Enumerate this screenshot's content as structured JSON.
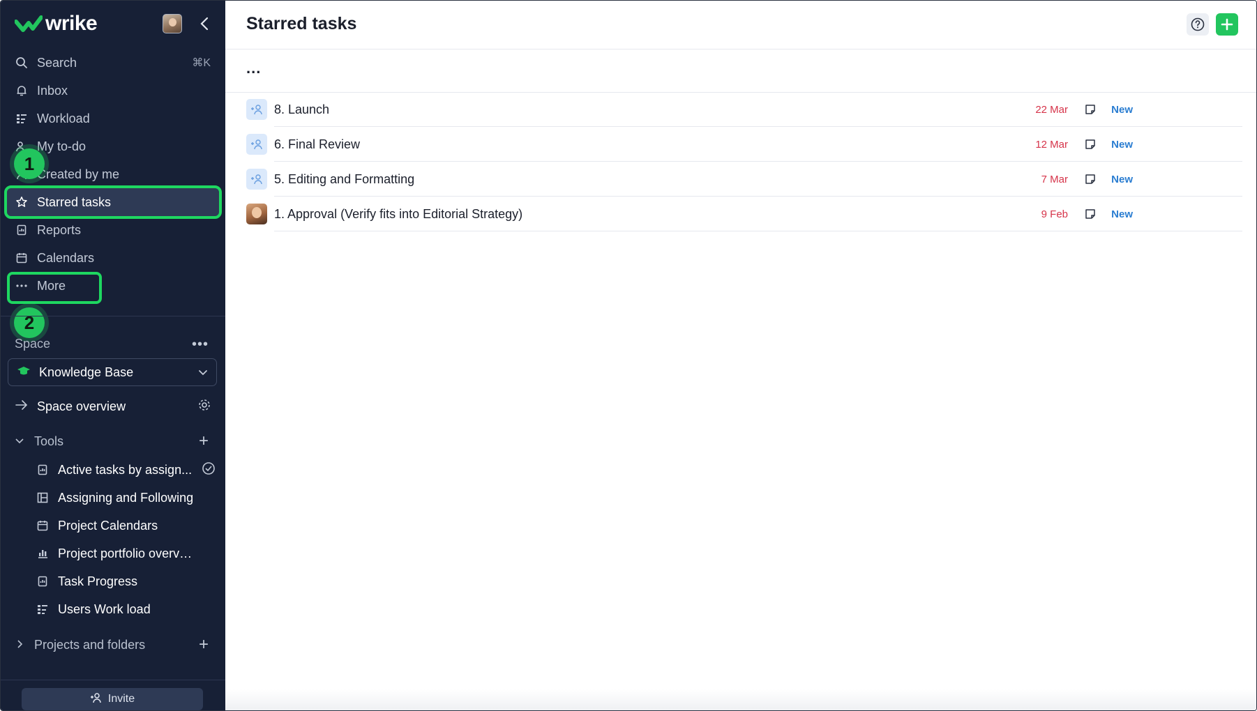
{
  "app": {
    "logo_text": "wrike"
  },
  "nav": {
    "items": [
      {
        "label": "Search",
        "shortcut": "⌘K",
        "icon": "search-icon"
      },
      {
        "label": "Inbox",
        "icon": "bell-icon"
      },
      {
        "label": "Workload",
        "icon": "workload-icon"
      },
      {
        "label": "My to-do",
        "icon": "todo-icon"
      },
      {
        "label": "Created by me",
        "icon": "user-icon"
      },
      {
        "label": "Starred tasks",
        "icon": "star-icon",
        "active": true
      },
      {
        "label": "Reports",
        "icon": "reports-icon"
      },
      {
        "label": "Calendars",
        "icon": "calendar-icon"
      },
      {
        "label": "More",
        "icon": "more-icon"
      }
    ]
  },
  "annotations": {
    "badge_1": "1",
    "badge_2": "2",
    "highlight_color": "#1ed760"
  },
  "space": {
    "label": "Space",
    "selected": "Knowledge Base",
    "overview_label": "Space overview"
  },
  "tools": {
    "label": "Tools",
    "items": [
      {
        "label": "Active tasks by assign...",
        "icon": "report-icon"
      },
      {
        "label": "Assigning and Following",
        "icon": "board-icon"
      },
      {
        "label": "Project Calendars",
        "icon": "calendar-icon"
      },
      {
        "label": "Project portfolio overview",
        "icon": "portfolio-icon"
      },
      {
        "label": "Task Progress",
        "icon": "report-icon"
      },
      {
        "label": "Users Work load",
        "icon": "workload-icon"
      }
    ]
  },
  "projects": {
    "label": "Projects and folders"
  },
  "invite": {
    "label": "Invite"
  },
  "main": {
    "title": "Starred tasks",
    "more_label": "...",
    "tasks": [
      {
        "title": "8. Launch",
        "date": "22 Mar",
        "status": "New",
        "assignee": "add-assignee"
      },
      {
        "title": "6. Final Review",
        "date": "12 Mar",
        "status": "New",
        "assignee": "add-assignee"
      },
      {
        "title": "5. Editing and Formatting",
        "date": "7 Mar",
        "status": "New",
        "assignee": "add-assignee"
      },
      {
        "title": "1. Approval (Verify fits into Editorial Strategy)",
        "date": "9 Feb",
        "status": "New",
        "assignee": "photo"
      }
    ]
  },
  "colors": {
    "sidebar_bg": "#172036",
    "accent": "#22c55e",
    "date": "#d6344a",
    "status": "#2a7dd1"
  }
}
